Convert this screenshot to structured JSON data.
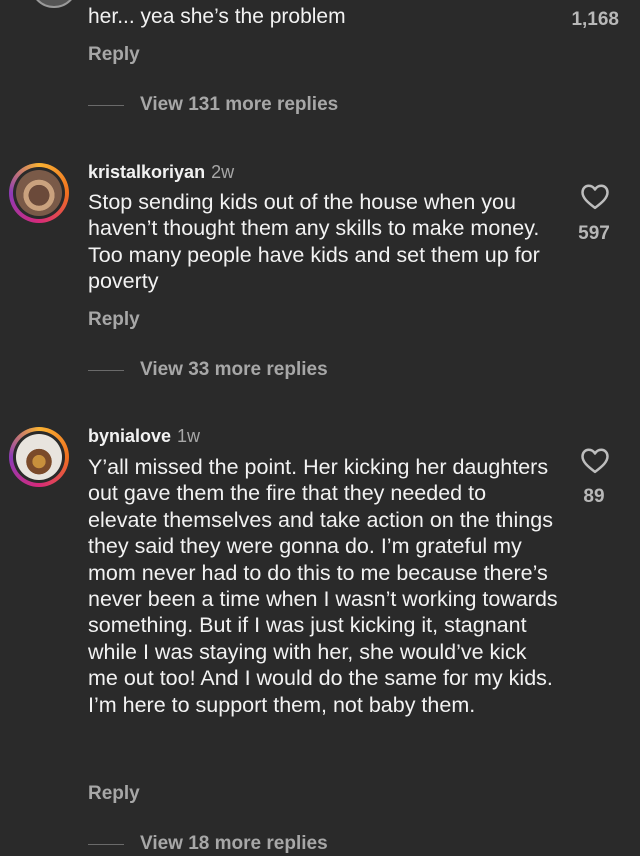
{
  "top_comment": {
    "text_line_partial": "her... yea she’s the problem",
    "likes": "1,168",
    "reply_label": "Reply",
    "view_more_label": "View 131 more replies"
  },
  "comments": [
    {
      "username": "kristalkoriyan",
      "time": "2w",
      "text": "Stop sending kids out of the house when you haven’t thought them any skills to make money. Too many people have kids and set them up for poverty",
      "likes": "597",
      "reply_label": "Reply",
      "view_more_label": "View 33 more replies"
    },
    {
      "username": "bynialove",
      "time": "1w",
      "text": "Y’all missed the point. Her kicking her daughters out gave them the fire that they needed to elevate themselves and take action on the things they said they were gonna do. I’m grateful my mom never had to do this to me because there’s never been a time when I wasn’t working towards something. But if I was just kicking it, stagnant while I was staying with her, she would’ve kick me out too! And I would do the same for my kids. I’m here to support them, not baby them.",
      "likes": "89",
      "reply_label": "Reply",
      "view_more_label": "View 18 more replies"
    }
  ],
  "icons": {
    "heart": "heart-outline-icon"
  },
  "colors": {
    "background": "#2a2a2a",
    "text_primary": "#f2f2f2",
    "text_secondary": "#a7a7a7",
    "story_ring": "#d62a7a"
  }
}
